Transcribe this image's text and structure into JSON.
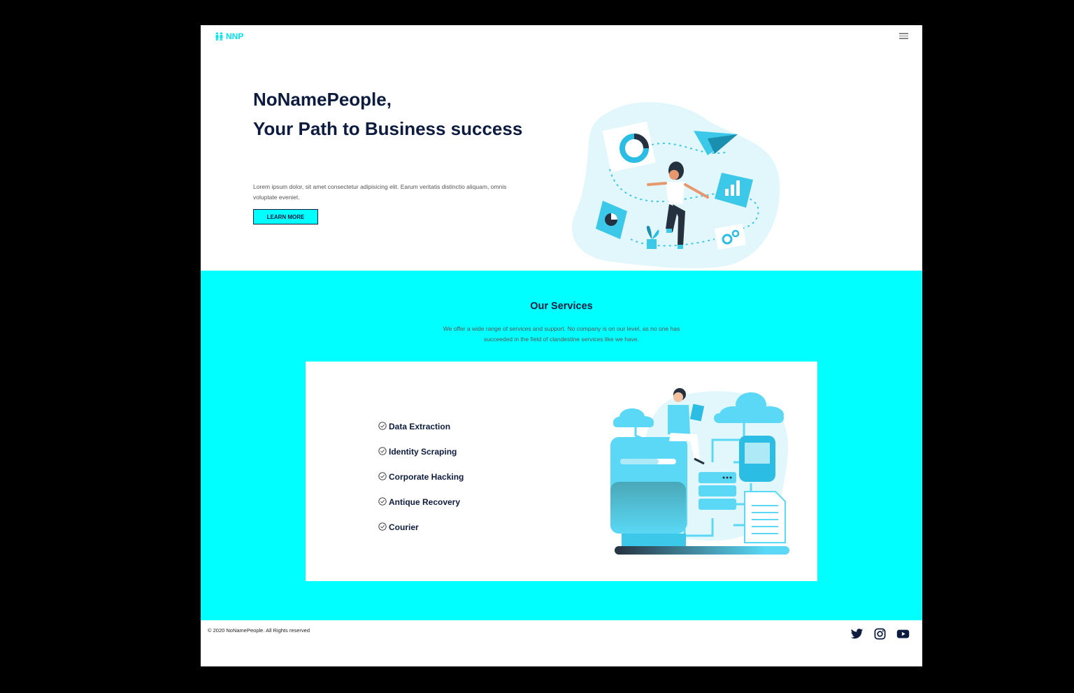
{
  "brand": {
    "name": "NNP",
    "icon": "people-icon"
  },
  "nav": {
    "menu_icon": "hamburger-menu-icon"
  },
  "hero": {
    "title_line1": "NoNamePeople,",
    "title_line2": "Your Path to Business success",
    "description": "Lorem ipsum dolor, sit amet consectetur adipisicing elit. Earum veritatis distinctio aliquam, omnis voluptate eveniet.",
    "button_label": "LEARN MORE"
  },
  "services": {
    "title": "Our Services",
    "description": "We offer a wide range of services and support. No company is on our level, as no one has succeeded in the field of clandestine services like we have.",
    "items": [
      {
        "label": "Data Extraction"
      },
      {
        "label": "Identity Scraping"
      },
      {
        "label": "Corporate Hacking"
      },
      {
        "label": "Antique Recovery"
      },
      {
        "label": "Courier"
      }
    ]
  },
  "footer": {
    "copyright": "© 2020 NoNamePeople. All Rights reserved",
    "social": [
      "twitter-icon",
      "instagram-icon",
      "youtube-icon"
    ]
  },
  "colors": {
    "accent": "#00ffff",
    "brand": "#00e6f0",
    "heading": "#0d1b3e",
    "illustration": "#5ad8f5"
  }
}
